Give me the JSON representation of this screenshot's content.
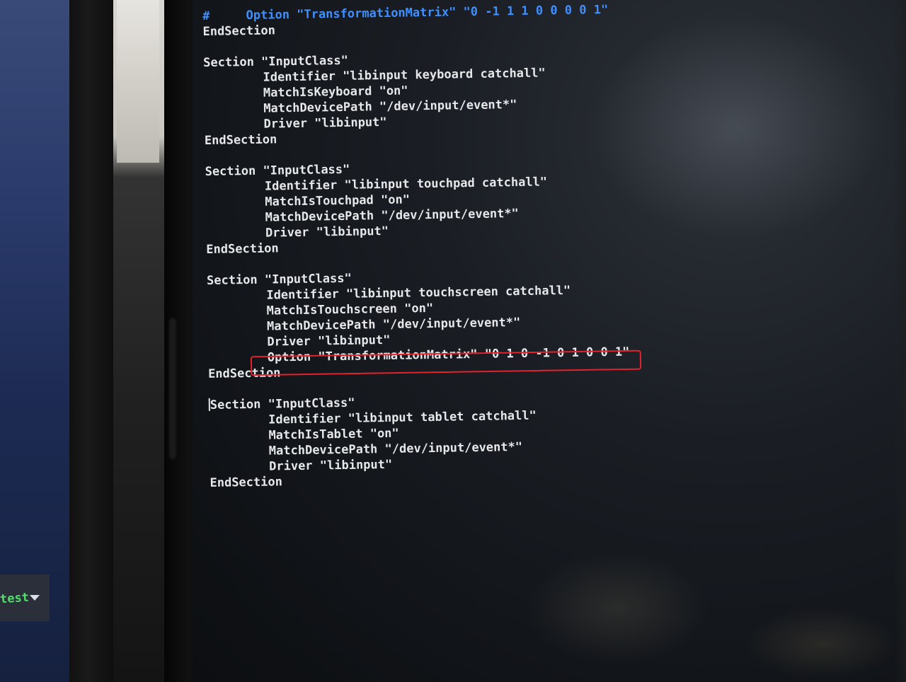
{
  "left_monitor": {
    "status_text": "test"
  },
  "terminal": {
    "lines": [
      {
        "text": "#     Option \"TransformationMatrix\" \"0 -1 1 1 0 0 0 0 1\"",
        "kind": "comment"
      },
      {
        "text": "EndSection",
        "kind": "normal"
      },
      {
        "text": "",
        "kind": "blank"
      },
      {
        "text": "Section \"InputClass\"",
        "kind": "normal"
      },
      {
        "text": "Identifier \"libinput keyboard catchall\"",
        "kind": "indent"
      },
      {
        "text": "MatchIsKeyboard \"on\"",
        "kind": "indent"
      },
      {
        "text": "MatchDevicePath \"/dev/input/event*\"",
        "kind": "indent"
      },
      {
        "text": "Driver \"libinput\"",
        "kind": "indent"
      },
      {
        "text": "EndSection",
        "kind": "normal"
      },
      {
        "text": "",
        "kind": "blank"
      },
      {
        "text": "Section \"InputClass\"",
        "kind": "normal"
      },
      {
        "text": "Identifier \"libinput touchpad catchall\"",
        "kind": "indent"
      },
      {
        "text": "MatchIsTouchpad \"on\"",
        "kind": "indent"
      },
      {
        "text": "MatchDevicePath \"/dev/input/event*\"",
        "kind": "indent"
      },
      {
        "text": "Driver \"libinput\"",
        "kind": "indent"
      },
      {
        "text": "EndSection",
        "kind": "normal"
      },
      {
        "text": "",
        "kind": "blank"
      },
      {
        "text": "Section \"InputClass\"",
        "kind": "normal"
      },
      {
        "text": "Identifier \"libinput touchscreen catchall\"",
        "kind": "indent"
      },
      {
        "text": "MatchIsTouchscreen \"on\"",
        "kind": "indent"
      },
      {
        "text": "MatchDevicePath \"/dev/input/event*\"",
        "kind": "indent"
      },
      {
        "text": "Driver \"libinput\"",
        "kind": "indent"
      },
      {
        "text": "Option \"TransformationMatrix\" \"0 1 0 -1 0 1 0 0 1\"",
        "kind": "indent"
      },
      {
        "text": "EndSection",
        "kind": "normal"
      },
      {
        "text": "",
        "kind": "blank"
      },
      {
        "text": "Section \"InputClass\"",
        "kind": "cursor"
      },
      {
        "text": "Identifier \"libinput tablet catchall\"",
        "kind": "indent"
      },
      {
        "text": "MatchIsTablet \"on\"",
        "kind": "indent"
      },
      {
        "text": "MatchDevicePath \"/dev/input/event*\"",
        "kind": "indent"
      },
      {
        "text": "Driver \"libinput\"",
        "kind": "indent"
      },
      {
        "text": "EndSection",
        "kind": "normal"
      }
    ]
  },
  "colors": {
    "text": "#e6e8ea",
    "comment": "#3f8fff",
    "highlight_ring": "#e3222b",
    "status_text": "#4fe06a"
  }
}
